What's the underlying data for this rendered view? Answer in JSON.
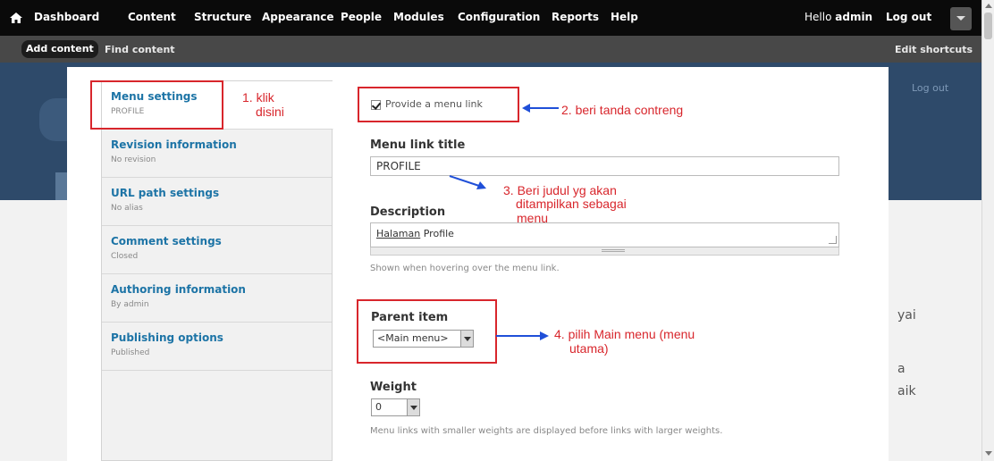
{
  "toolbar": {
    "items": [
      "Dashboard",
      "Content",
      "Structure",
      "Appearance",
      "People",
      "Modules",
      "Configuration",
      "Reports",
      "Help"
    ],
    "hello_prefix": "Hello",
    "hello_user": "admin",
    "logout": "Log out"
  },
  "shortcuts": {
    "add_content": "Add content",
    "find_content": "Find content",
    "edit_shortcuts": "Edit shortcuts"
  },
  "background": {
    "logout": "Log out",
    "fragments": [
      "yai",
      "a",
      "aik"
    ]
  },
  "vertical_tabs": [
    {
      "title": "Menu settings",
      "summary": "PROFILE"
    },
    {
      "title": "Revision information",
      "summary": "No revision"
    },
    {
      "title": "URL path settings",
      "summary": "No alias"
    },
    {
      "title": "Comment settings",
      "summary": "Closed"
    },
    {
      "title": "Authoring information",
      "summary": "By admin"
    },
    {
      "title": "Publishing options",
      "summary": "Published"
    }
  ],
  "form": {
    "provide_menu_link": "Provide a menu link",
    "provide_checked": true,
    "menu_link_title_label": "Menu link title",
    "menu_link_title_value": "PROFILE",
    "description_label": "Description",
    "description_word1": "Halaman",
    "description_word2": " Profile",
    "description_hint": "Shown when hovering over the menu link.",
    "parent_item_label": "Parent item",
    "parent_item_value": "<Main menu>",
    "weight_label": "Weight",
    "weight_value": "0",
    "weight_hint": "Menu links with smaller weights are displayed before links with larger weights."
  },
  "annotations": {
    "step1_line1": "1. klik",
    "step1_line2": "disini",
    "step2": "2. beri tanda contreng",
    "step3_line1": "3. Beri judul yg akan",
    "step3_line2": "ditampilkan sebagai",
    "step3_line3": "menu",
    "step4_line1": "4. pilih Main menu (menu",
    "step4_line2": "utama)"
  },
  "colors": {
    "annotation_red": "#d8262c",
    "annotation_blue": "#1f4fd8",
    "link_blue": "#1d74a6",
    "toolbar_bg": "#0a0a0a",
    "header_blue": "#2e4a6a"
  }
}
